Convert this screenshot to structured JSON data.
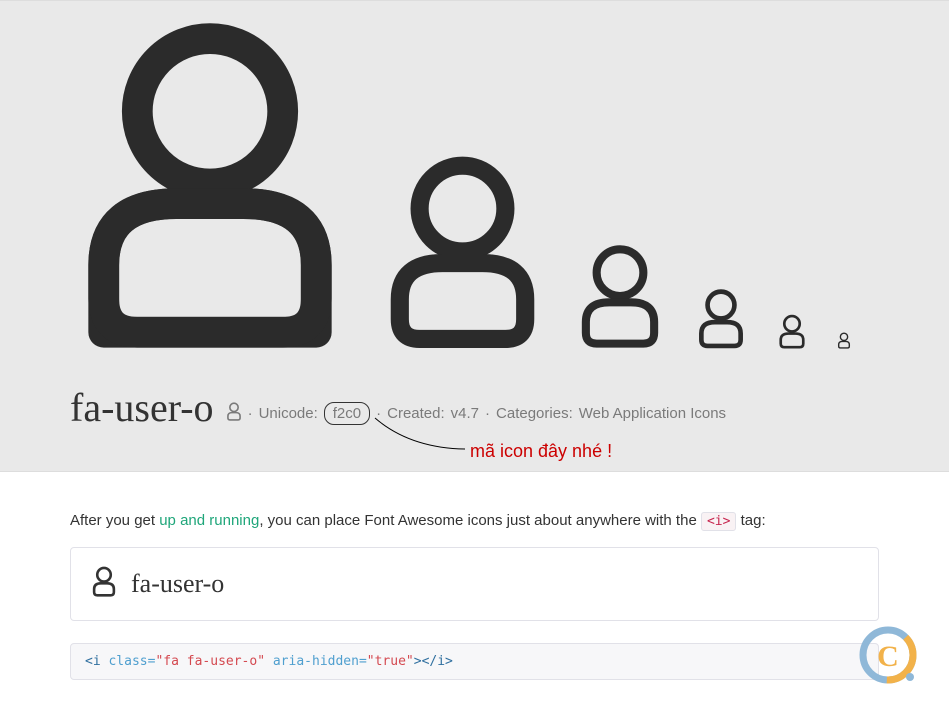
{
  "header": {
    "icon_name": "fa-user-o",
    "meta_unicode_label": "Unicode:",
    "meta_unicode_value": "f2c0",
    "meta_created_label": "Created:",
    "meta_created_value": "v4.7",
    "meta_categories_label": "Categories:",
    "meta_categories_value": "Web Application Icons",
    "separator": "·"
  },
  "annotation": {
    "text": "mã icon đây nhé !"
  },
  "description": {
    "prefix": "After you get ",
    "link": "up and running",
    "suffix": ", you can place Font Awesome icons just about anywhere with the ",
    "code": "<i>",
    "tail": " tag:"
  },
  "example": {
    "label": "fa-user-o"
  },
  "code": {
    "open_tag": "<i",
    "class_attr": " class=",
    "class_val": "\"fa fa-user-o\"",
    "aria_attr": " aria-hidden=",
    "aria_val": "\"true\"",
    "close": "></i>"
  }
}
